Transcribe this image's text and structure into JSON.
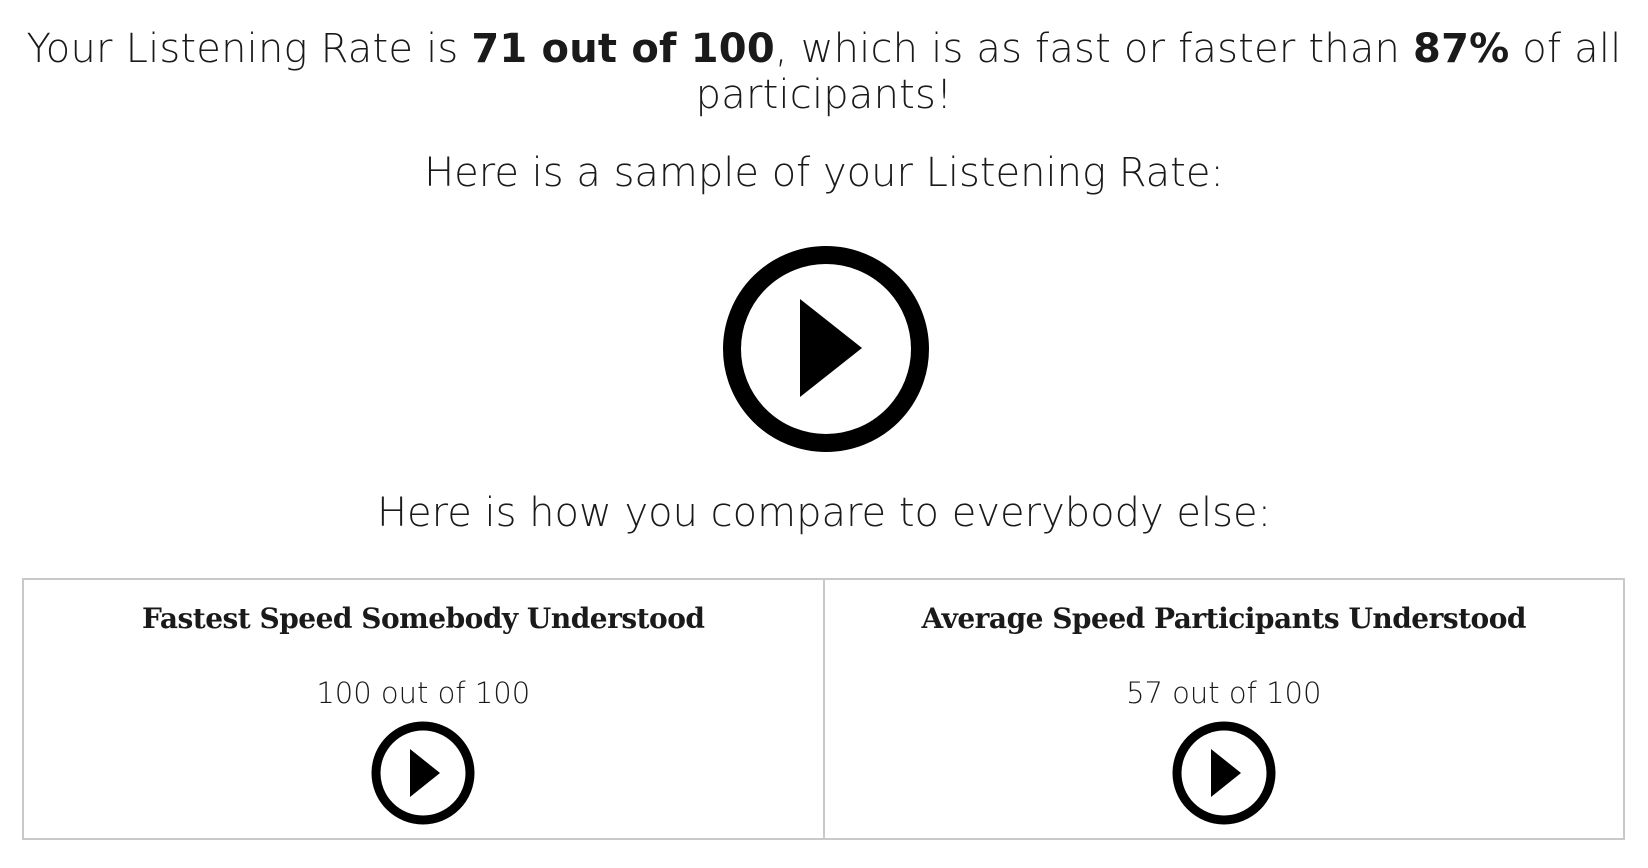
{
  "result": {
    "prefix": "Your Listening Rate is ",
    "rate": "71 out of 100",
    "middle": ", which is as fast or faster than ",
    "percent": "87%",
    "suffix": " of all participants!"
  },
  "sample": {
    "heading": "Here is a sample of your Listening Rate:",
    "play_icon": "play-circle-icon"
  },
  "compare": {
    "heading": "Here is how you compare to everybody else:",
    "cells": [
      {
        "title": "Fastest Speed Somebody Understood",
        "value": "100 out of 100",
        "play_icon": "play-circle-icon"
      },
      {
        "title": "Average Speed Participants Understood",
        "value": "57 out of 100",
        "play_icon": "play-circle-icon"
      }
    ]
  },
  "colors": {
    "text": "#1a1a1a",
    "icon": "#000000",
    "border": "#c9c9c9",
    "background": "#ffffff"
  }
}
